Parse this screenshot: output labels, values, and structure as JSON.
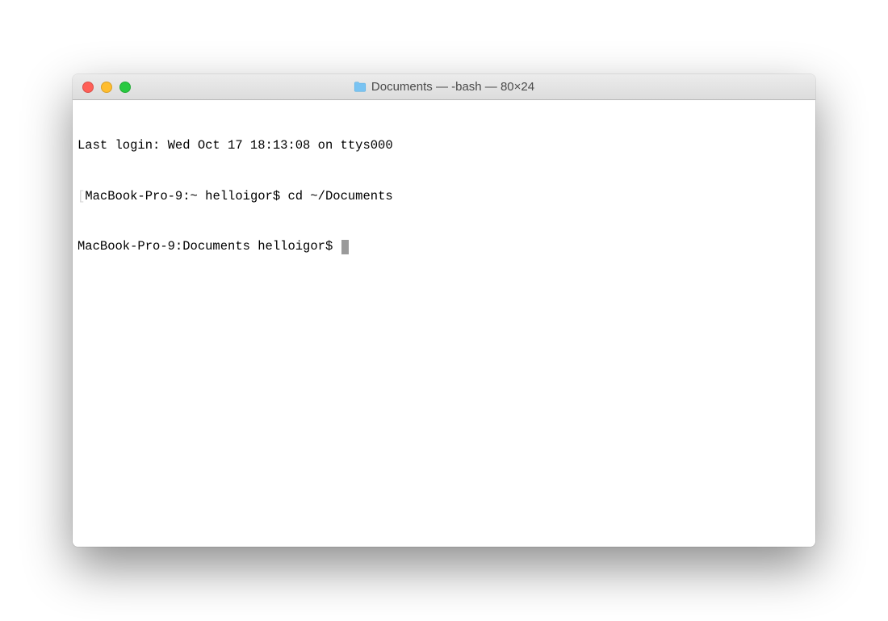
{
  "window": {
    "title": "Documents — -bash — 80×24"
  },
  "terminal": {
    "last_login": "Last login: Wed Oct 17 18:13:08 on ttys000",
    "line1_prompt": "MacBook-Pro-9:~ helloigor$ ",
    "line1_command": "cd ~/Documents",
    "line2_prompt": "MacBook-Pro-9:Documents helloigor$ "
  }
}
